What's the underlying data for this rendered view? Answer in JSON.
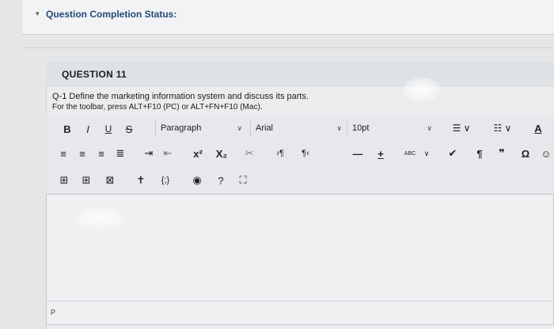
{
  "status": {
    "label": "Question Completion Status:"
  },
  "question": {
    "title": "QUESTION 11",
    "text": "Q-1 Define the marketing information system and discuss its parts.",
    "hint": "For the toolbar, press ALT+F10 (PC) or ALT+FN+F10 (Mac)."
  },
  "toolbar": {
    "bold": "B",
    "italic": "I",
    "underline": "U",
    "strike": "S",
    "paragraph": "Paragraph",
    "font": "Arial",
    "size": "10pt",
    "superscript": "x²",
    "subscript": "X₂",
    "paragraph_mark": "¶",
    "quote": "❞",
    "omega": "Ω",
    "a_color": "A",
    "spell": "ABC",
    "add": "+",
    "minus": "—"
  },
  "path": {
    "text": "P"
  },
  "colors": {
    "accent": "#234a7a"
  }
}
